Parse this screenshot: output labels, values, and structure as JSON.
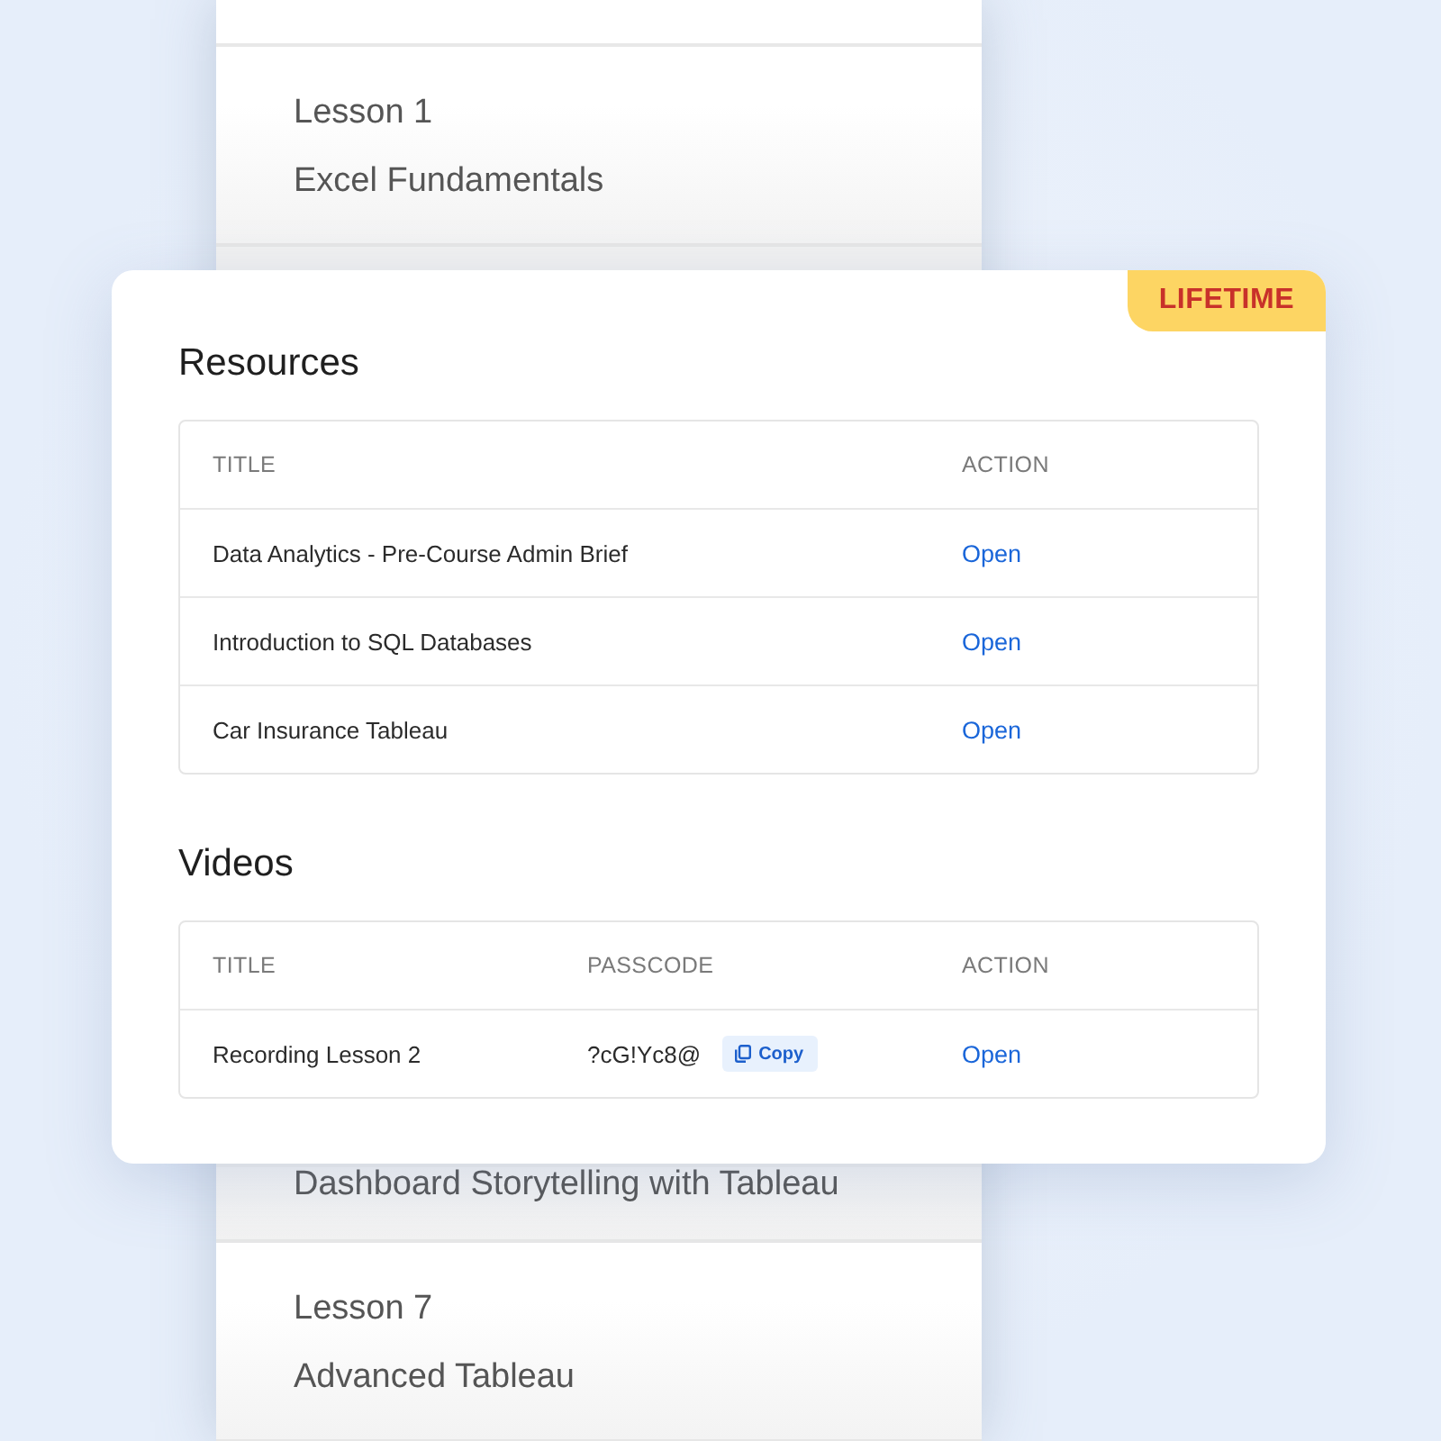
{
  "lesson_list": [
    {
      "number": "Lesson 1",
      "title": "Excel Fundamentals"
    },
    {
      "title": "Dashboard Storytelling with Tableau"
    },
    {
      "number": "Lesson 7",
      "title": "Advanced Tableau"
    }
  ],
  "card": {
    "badge": "LIFETIME",
    "sections": [
      {
        "heading": "Resources",
        "columns": [
          "TITLE",
          "ACTION"
        ],
        "rows": [
          {
            "title": "Data Analytics - Pre-Course Admin Brief",
            "action": "Open"
          },
          {
            "title": "Introduction to SQL Databases",
            "action": "Open"
          },
          {
            "title": "Car Insurance Tableau",
            "action": "Open"
          }
        ]
      },
      {
        "heading": "Videos",
        "columns": [
          "TITLE",
          "PASSCODE",
          "ACTION"
        ],
        "rows": [
          {
            "title": "Recording Lesson 2",
            "passcode": "?cG!Yc8@",
            "copy": "Copy",
            "action": "Open"
          }
        ]
      }
    ]
  }
}
